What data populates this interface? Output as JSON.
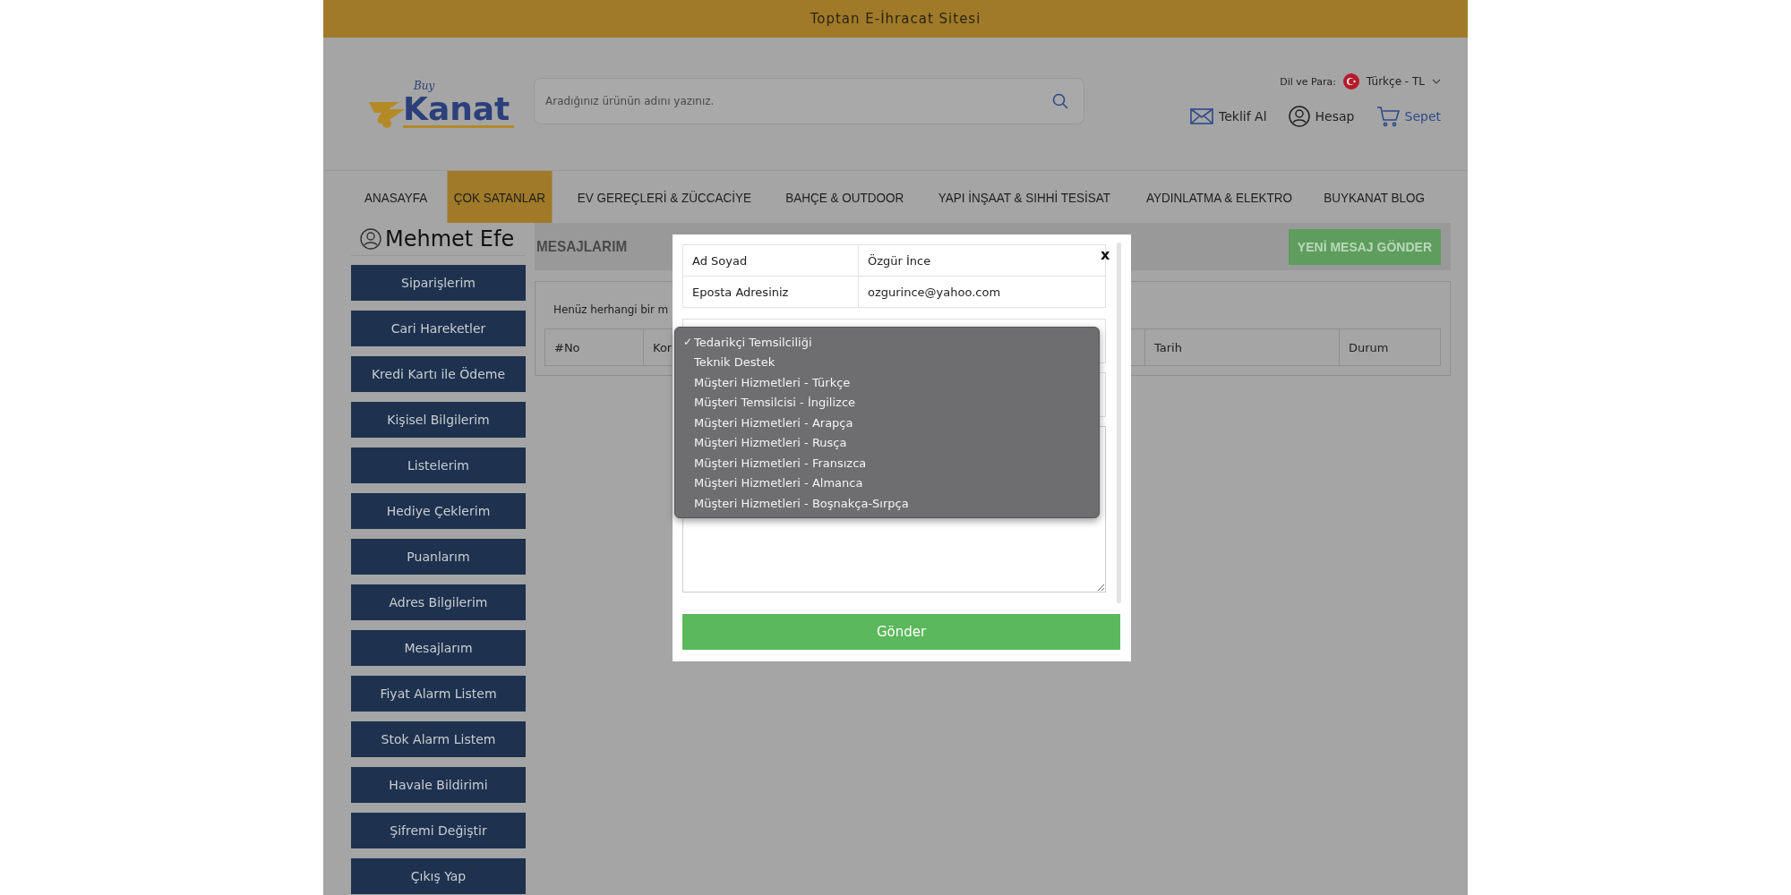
{
  "top_banner": {
    "text": "Toptan E-İhracat Sitesi"
  },
  "header": {
    "logo": {
      "small_text": "Buy",
      "brand": "Kanat"
    },
    "search": {
      "placeholder": "Aradığınız ürünün adını yazınız."
    },
    "language": {
      "label": "Dil ve Para:",
      "value": "Türkçe - TL"
    },
    "actions": [
      {
        "kind": "quote",
        "label": "Teklif Al"
      },
      {
        "kind": "account",
        "label": "Hesap"
      },
      {
        "kind": "cart",
        "label": "Sepet"
      }
    ]
  },
  "nav": [
    {
      "label": "ANASAYFA",
      "selected": false
    },
    {
      "label": "ÇOK SATANLAR",
      "selected": true
    },
    {
      "label": "EV GEREÇLERİ & ZÜCCACİYE",
      "selected": false
    },
    {
      "label": "BAHÇE & OUTDOOR",
      "selected": false
    },
    {
      "label": "YAPI İNŞAAT & SIHHİ TESİSAT",
      "selected": false
    },
    {
      "label": "AYDINLATMA & ELEKTRO",
      "selected": false
    },
    {
      "label": "BUYKANAT BLOG",
      "selected": false
    }
  ],
  "sidebar": {
    "user_name": "Mehmet Efe",
    "items": [
      "Siparişlerim",
      "Cari Hareketler",
      "Kredi Kartı ile Ödeme",
      "Kişisel Bilgilerim",
      "Listelerim",
      "Hediye Çeklerim",
      "Puanlarım",
      "Adres Bilgilerim",
      "Mesajlarım",
      "Fiyat Alarm Listem",
      "Stok Alarm Listem",
      "Havale Bildirimi",
      "Şifremi Değiştir",
      "Çıkış Yap"
    ]
  },
  "main": {
    "title": "MESAJLARIM",
    "new_message_button": "YENİ MESAJ GÖNDER",
    "empty_text": "Henüz herhangi bir m",
    "table": {
      "columns": [
        "#No",
        "Kor",
        "Tarih",
        "Durum"
      ]
    }
  },
  "modal": {
    "close": "x",
    "rows": [
      {
        "label": "Ad Soyad",
        "value": "Özgür İnce"
      },
      {
        "label": "Eposta Adresiniz",
        "value": "ozgurince@yahoo.com"
      }
    ],
    "dropdown": {
      "check_mark": "✓",
      "options": [
        {
          "label": "Tedarikçi Temsilciliği",
          "selected": true
        },
        {
          "label": "Teknik Destek",
          "selected": false
        },
        {
          "label": "Müşteri Hizmetleri - Türkçe",
          "selected": false
        },
        {
          "label": "Müşteri Temsilcisi - İngilizce",
          "selected": false
        },
        {
          "label": "Müşteri Hizmetleri - Arapça",
          "selected": false
        },
        {
          "label": "Müşteri Hizmetleri - Rusça",
          "selected": false
        },
        {
          "label": "Müşteri Hizmetleri - Fransızca",
          "selected": false
        },
        {
          "label": "Müşteri Hizmetleri - Almanca",
          "selected": false
        },
        {
          "label": "Müşteri Hizmetleri - Boşnakça-Sırpça",
          "selected": false
        }
      ]
    },
    "submit_button": "Gönder"
  }
}
